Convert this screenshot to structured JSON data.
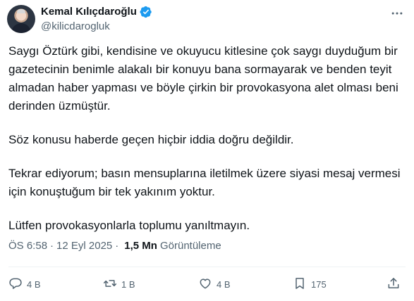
{
  "author": {
    "display_name": "Kemal Kılıçdaroğlu",
    "handle": "@kilicdarogluk"
  },
  "tweet": {
    "paragraphs": [
      "Saygı Öztürk gibi, kendisine ve okuyucu kitlesine çok saygı duyduğum bir gazetecinin benimle alakalı bir konuyu bana sormayarak ve benden teyit almadan haber yapması ve böyle çirkin bir provokasyona alet olması beni derinden üzmüştür.",
      "Söz konusu haberde geçen hiçbir iddia doğru değildir.",
      "Tekrar ediyorum; basın mensuplarına iletilmek üzere siyasi mesaj vermesi için konuştuğum bir tek yakınım yoktur.",
      "Lütfen provokasyonlarla toplumu yanıltmayın."
    ]
  },
  "meta": {
    "time": "ÖS 6:58",
    "separator": "·",
    "date": "12 Eyl 2025",
    "separator2": "·",
    "views_count": "1,5 Mn",
    "views_label": "Görüntüleme"
  },
  "actions": {
    "replies": "4 B",
    "reposts": "1 B",
    "likes": "4 B",
    "bookmarks": "175"
  },
  "colors": {
    "verified": "#1d9bf0",
    "secondary_text": "#536471",
    "primary_text": "#0f1419"
  },
  "icons": {
    "verified": "verified-badge-icon",
    "more": "more-dots-icon",
    "reply": "reply-icon",
    "repost": "repost-icon",
    "like": "heart-icon",
    "bookmark": "bookmark-icon",
    "share": "share-icon"
  }
}
